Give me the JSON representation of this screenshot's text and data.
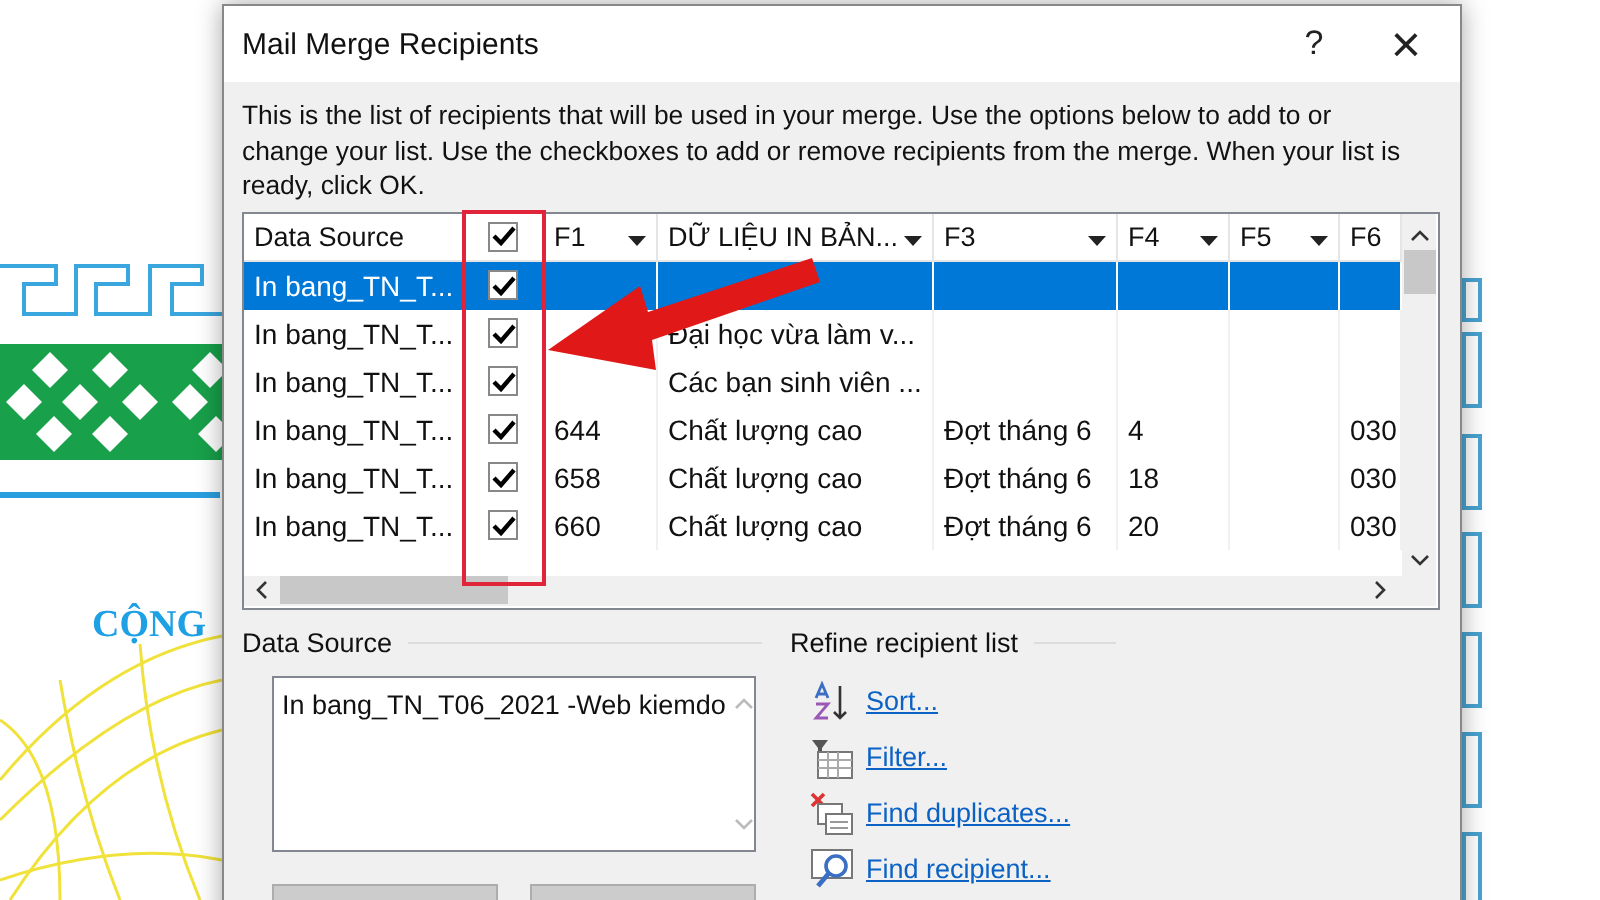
{
  "background_document": {
    "heading": "CỘNG"
  },
  "dialog": {
    "title": "Mail Merge Recipients",
    "help": "?",
    "close": "×"
  },
  "description": "This is the list of recipients that will be used in your merge.  Use the options below to add to or change your list.  Use the checkboxes to add or remove recipients from the merge.  When your list is ready, click OK.",
  "table": {
    "select_all_checked": true,
    "columns": [
      {
        "kind": "text",
        "label": "Data Source"
      },
      {
        "kind": "filter",
        "label": "F1"
      },
      {
        "kind": "filter",
        "label": "DỮ LIỆU IN BẢN..."
      },
      {
        "kind": "filter",
        "label": "F3"
      },
      {
        "kind": "filter",
        "label": "F4"
      },
      {
        "kind": "filter",
        "label": "F5"
      },
      {
        "kind": "text",
        "label": "F6"
      }
    ],
    "rows": [
      {
        "selected": true,
        "checked": true,
        "cells": [
          "In bang_TN_T...",
          "",
          "",
          "",
          "",
          "",
          ""
        ]
      },
      {
        "selected": false,
        "checked": true,
        "cells": [
          "In bang_TN_T...",
          "",
          "Đại học vừa làm v...",
          "",
          "",
          "",
          ""
        ]
      },
      {
        "selected": false,
        "checked": true,
        "cells": [
          "In bang_TN_T...",
          "",
          "Các bạn sinh viên ...",
          "",
          "",
          "",
          ""
        ]
      },
      {
        "selected": false,
        "checked": true,
        "cells": [
          "In bang_TN_T...",
          "644",
          "Chất lượng cao",
          "Đợt tháng 6",
          "4",
          "",
          "030"
        ]
      },
      {
        "selected": false,
        "checked": true,
        "cells": [
          "In bang_TN_T...",
          "658",
          "Chất lượng cao",
          "Đợt tháng 6",
          "18",
          "",
          "030"
        ]
      },
      {
        "selected": false,
        "checked": true,
        "cells": [
          "In bang_TN_T...",
          "660",
          "Chất lượng cao",
          "Đợt tháng 6",
          "20",
          "",
          "030"
        ]
      }
    ]
  },
  "source_group": {
    "label": "Data Source",
    "items": [
      "In bang_TN_T06_2021 -Web kiemdo"
    ]
  },
  "refine": {
    "label": "Refine recipient list",
    "links": [
      {
        "kind": "sort",
        "label": "Sort..."
      },
      {
        "kind": "filter",
        "label": "Filter..."
      },
      {
        "kind": "duplicates",
        "label": "Find duplicates..."
      },
      {
        "kind": "find",
        "label": "Find recipient..."
      }
    ]
  }
}
